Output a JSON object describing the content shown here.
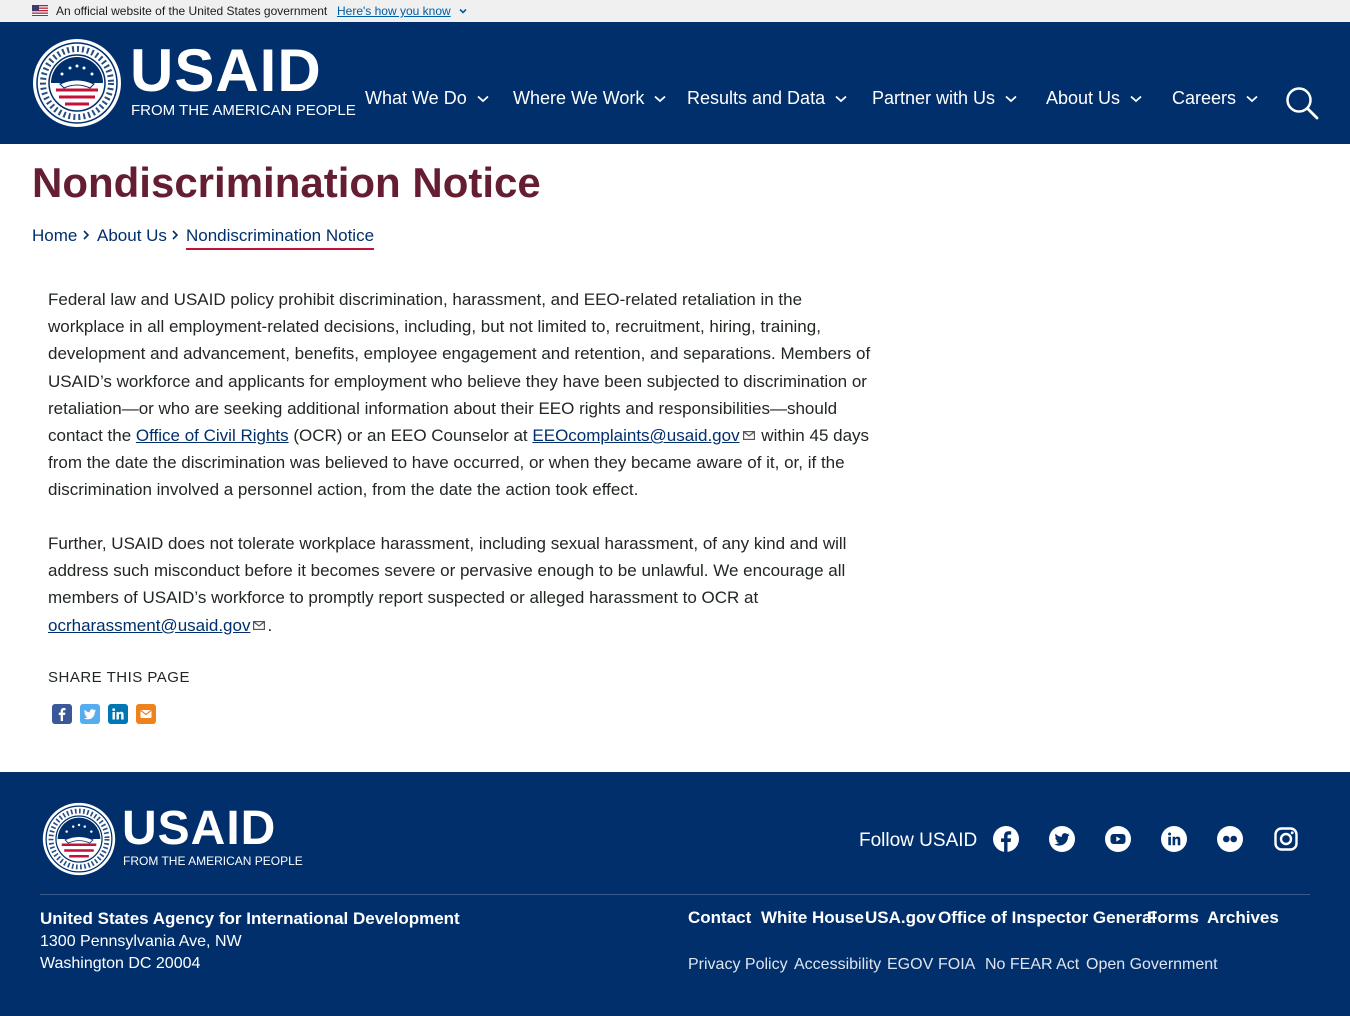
{
  "gov_banner": {
    "official_text": "An official website of the United States government",
    "how_you_know": "Here's how you know"
  },
  "header": {
    "wordmark": "USAID",
    "tagline": "FROM THE AMERICAN PEOPLE",
    "nav": [
      {
        "label": "What We Do"
      },
      {
        "label": "Where We Work"
      },
      {
        "label": "Results and Data"
      },
      {
        "label": "Partner with Us"
      },
      {
        "label": "About Us"
      },
      {
        "label": "Careers"
      }
    ]
  },
  "page": {
    "title": "Nondiscrimination Notice",
    "breadcrumb": [
      "Home",
      "About Us",
      "Nondiscrimination Notice"
    ],
    "p1_a": "Federal law and USAID policy prohibit discrimination, harassment, and EEO-related retaliation in the workplace in all employment-related decisions, including, but not limited to, recruitment, hiring, training, development and advancement, benefits, employee engagement and retention, and separations. Members of USAID’s workforce and applicants for employment who believe they have been subjected to discrimination or retaliation—or who are seeking additional information about their EEO rights and responsibilities—should contact the ",
    "p1_link1": "Office of Civil Rights",
    "p1_b": " (OCR) or an EEO Counselor at ",
    "p1_link2": "EEOcomplaints@usaid.gov",
    "p1_c": " within 45 days from the date the discrimination was believed to have occurred, or when they became aware of it, or, if the discrimination involved a personnel action, from the date the action took effect.",
    "p2_a": "Further, USAID does not tolerate workplace harassment, including sexual harassment, of any kind and will address such misconduct before it becomes severe or pervasive enough to be unlawful. We encourage all members of USAID’s workforce to promptly report suspected or alleged harassment to OCR at ",
    "p2_link": "ocrharassment@usaid.gov",
    "p2_b": ".",
    "share_label": "SHARE THIS PAGE"
  },
  "footer": {
    "wordmark": "USAID",
    "tagline": "FROM THE AMERICAN PEOPLE",
    "follow": "Follow USAID",
    "agency": "United States Agency for International Development",
    "address_line1": "1300 Pennsylvania Ave, NW",
    "address_line2": "Washington DC 20004",
    "links_primary": [
      "Contact",
      "White House",
      "USA.gov",
      "Office of Inspector General",
      "Forms",
      "Archives"
    ],
    "links_secondary": [
      "Privacy Policy",
      "Accessibility",
      "EGOV",
      "FOIA",
      "No FEAR Act",
      "Open Government"
    ]
  },
  "colors": {
    "navy": "#002f6c",
    "title_maroon": "#651d32",
    "breadcrumb_underline": "#c2113a",
    "facebook": "#3b5998",
    "twitter": "#55acee",
    "linkedin": "#0077b5",
    "email": "#f0821e"
  }
}
